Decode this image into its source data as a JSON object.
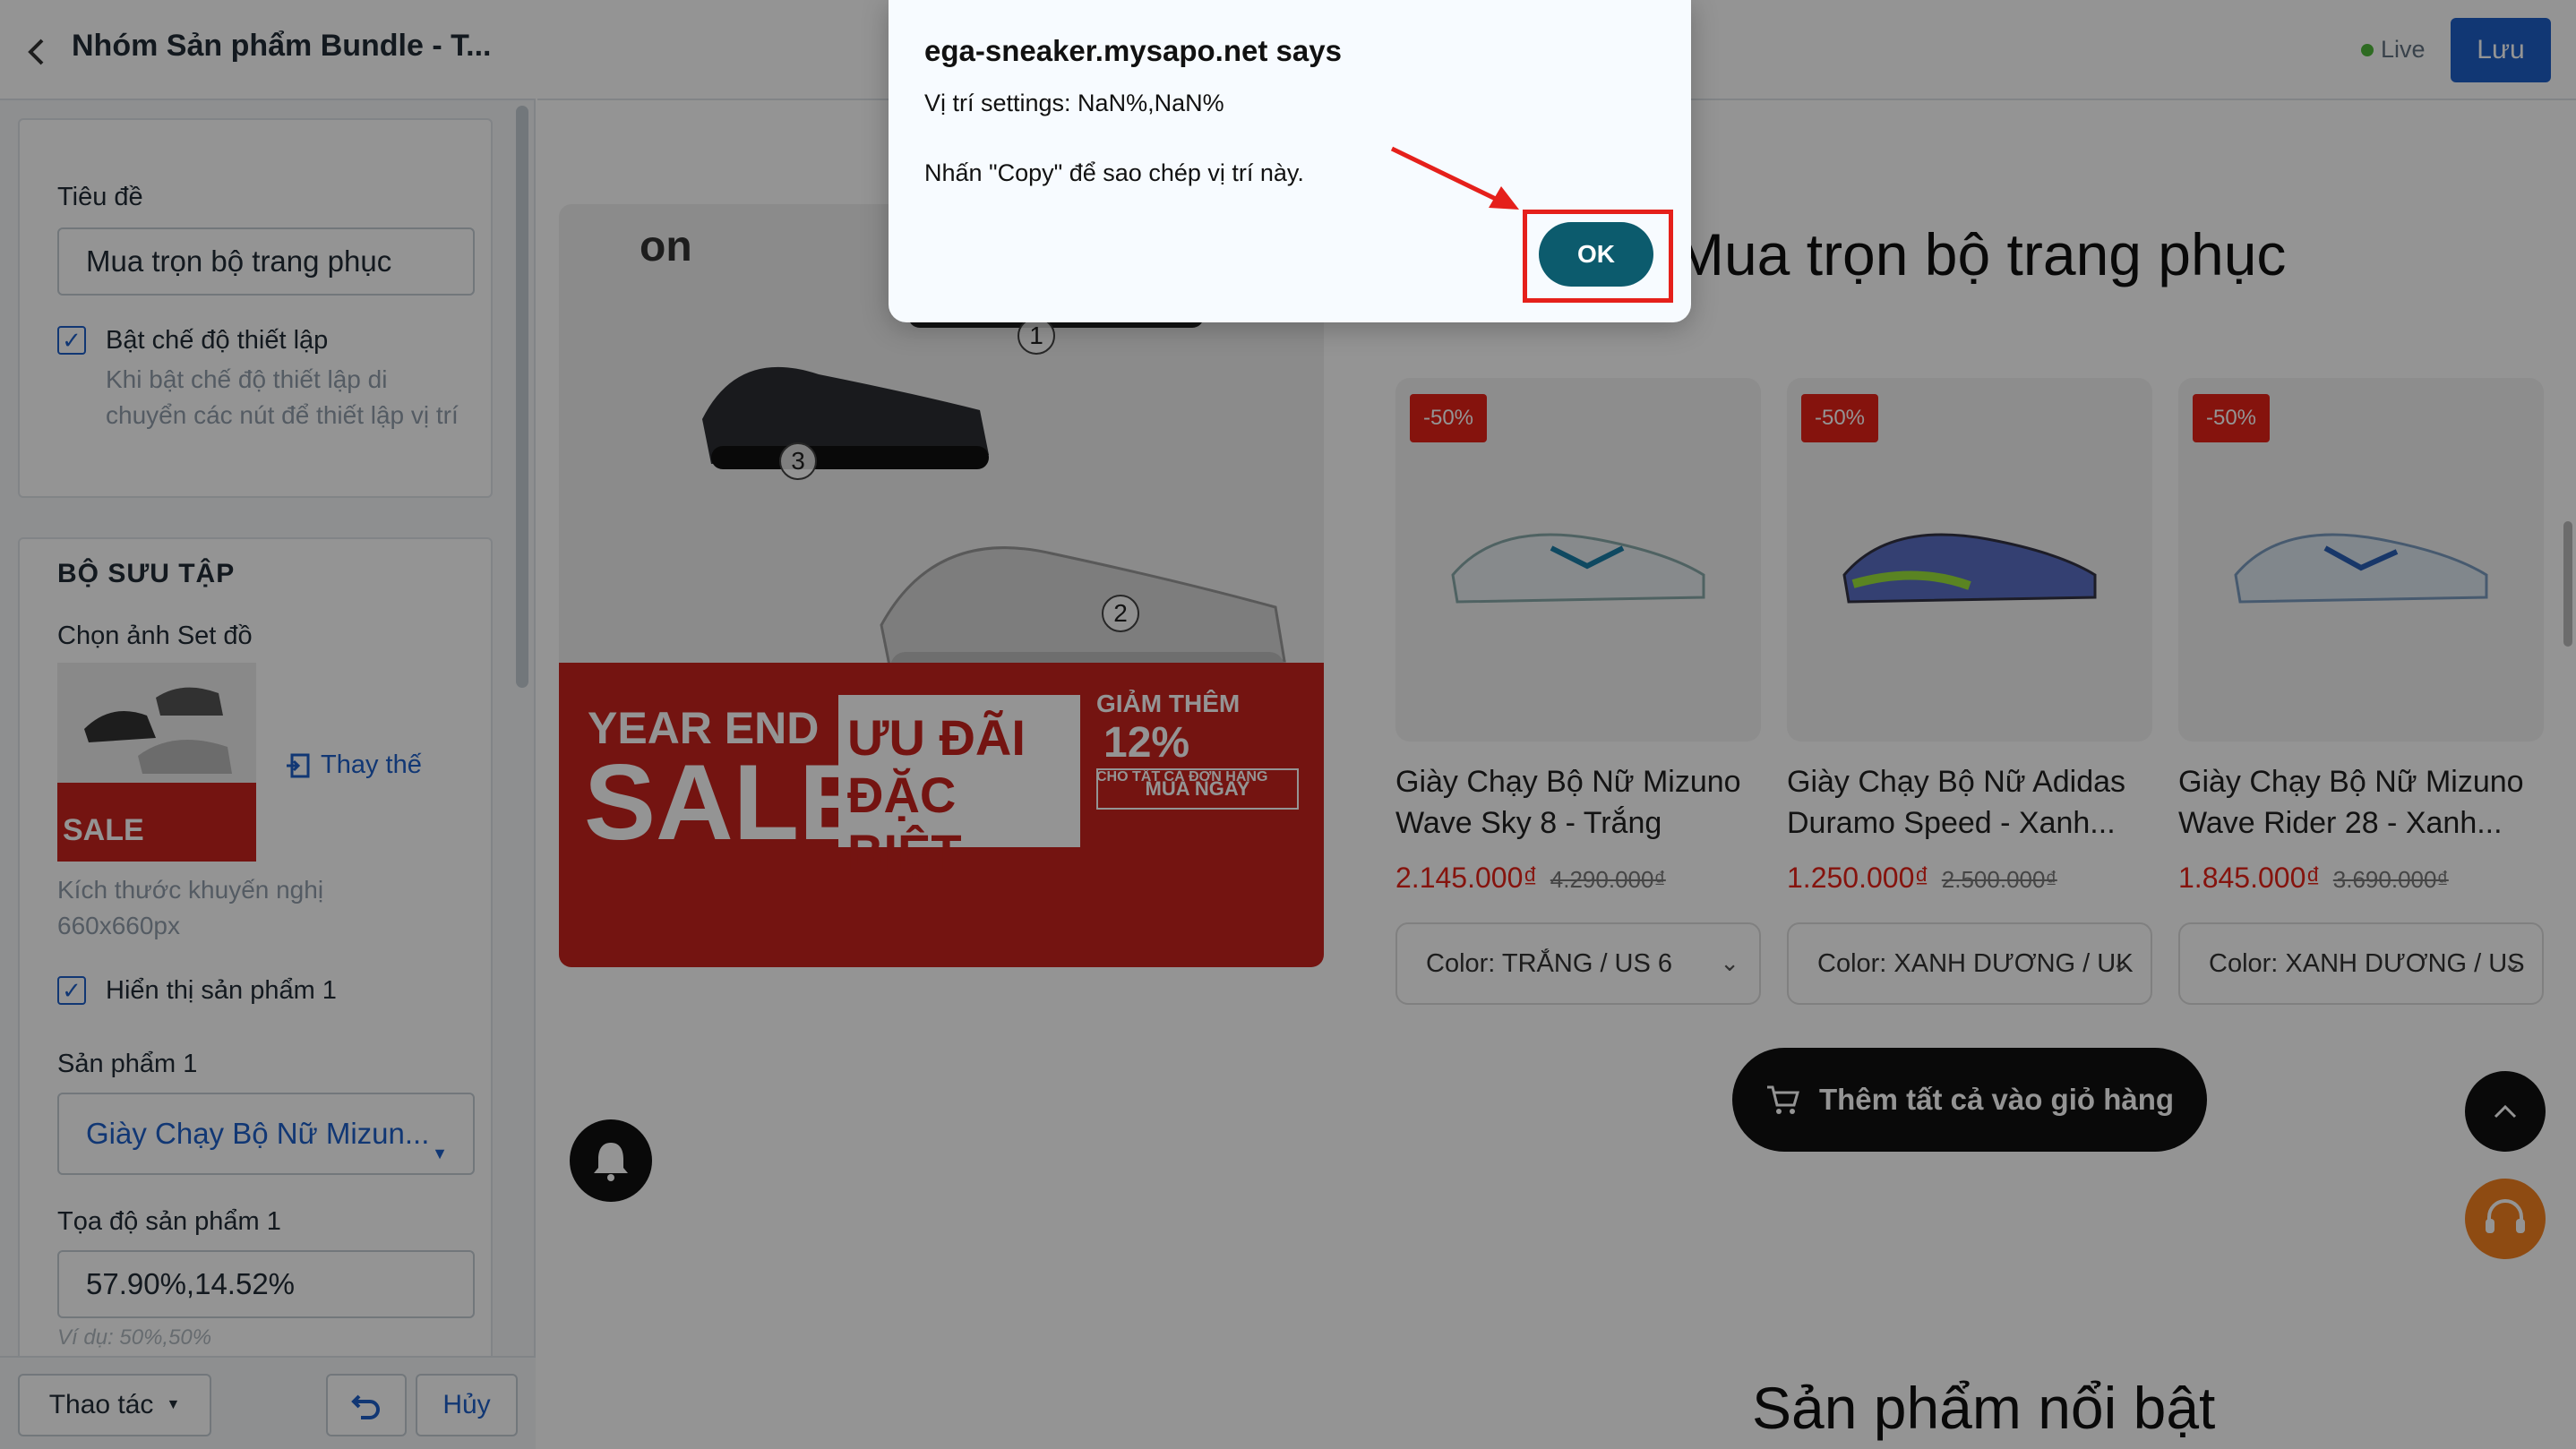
{
  "sidebar": {
    "title": "Nhóm Sản phẩm Bundle - T...",
    "card1": {
      "title_label": "Tiêu đề",
      "title_value": "Mua trọn bộ trang phục",
      "setup_checkbox_label": "Bật chế độ thiết lập",
      "setup_help": "Khi bật chế độ thiết lập di chuyển các nút để thiết lập vị trí"
    },
    "card2": {
      "heading": "BỘ SƯU TẬP",
      "image_label": "Chọn ảnh Set đồ",
      "replace_label": "Thay thế",
      "size_hint": "Kích thước khuyến nghị 660x660px",
      "show_product1_label": "Hiển thị sản phẩm 1",
      "product1_label": "Sản phẩm 1",
      "product1_value": "Giày Chạy Bộ Nữ Mizun...",
      "coord1_label": "Tọa độ sản phẩm 1",
      "coord1_value": "57.90%,14.52%",
      "coord1_hint": "Ví dụ: 50%,50%"
    },
    "footer": {
      "actions_label": "Thao tác",
      "cancel_label": "Hủy"
    }
  },
  "topbar": {
    "live_label": "Live",
    "save_label": "Lưu"
  },
  "banner": {
    "logo": "on",
    "markers": [
      "1",
      "2",
      "3"
    ],
    "year_end": "YEAR END",
    "sale": "SALE",
    "promo_line1": "ƯU ĐÃI",
    "promo_line2": "ĐẶC BIỆT",
    "discount_label": "GIẢM THÊM",
    "discount_value": "12%",
    "discount_sub": "CHO TẤT CẢ ĐƠN HÀNG",
    "cta": "MUA NGAY"
  },
  "section_title": "Mua trọn bộ trang phục",
  "products": [
    {
      "badge": "-50%",
      "name": "Giày Chạy Bộ Nữ Mizuno Wave Sky 8 - Trắng",
      "price": "2.145.000₫",
      "old_price": "4.290.000₫",
      "variant": "Color: TRẮNG / US 6"
    },
    {
      "badge": "-50%",
      "name": "Giày Chạy Bộ Nữ Adidas Duramo Speed - Xanh...",
      "price": "1.250.000₫",
      "old_price": "2.500.000₫",
      "variant": "Color: XANH DƯƠNG / UK"
    },
    {
      "badge": "-50%",
      "name": "Giày Chạy Bộ Nữ Mizuno Wave Rider 28 - Xanh...",
      "price": "1.845.000₫",
      "old_price": "3.690.000₫",
      "variant": "Color: XANH DƯƠNG / US"
    }
  ],
  "add_all_label": "Thêm tất cả vào giỏ hàng",
  "featured_title": "Sản phẩm nổi bật",
  "dialog": {
    "title": "ega-sneaker.mysapo.net says",
    "message1": "Vị trí settings: NaN%,NaN%",
    "message2": "Nhấn \"Copy\" để sao chép vị trí này.",
    "ok_label": "OK"
  },
  "colors": {
    "primary_blue": "#1e5fc9",
    "ok_button": "#0c5b6d",
    "sale_red": "#e62117",
    "highlight_red": "#e5201b"
  }
}
